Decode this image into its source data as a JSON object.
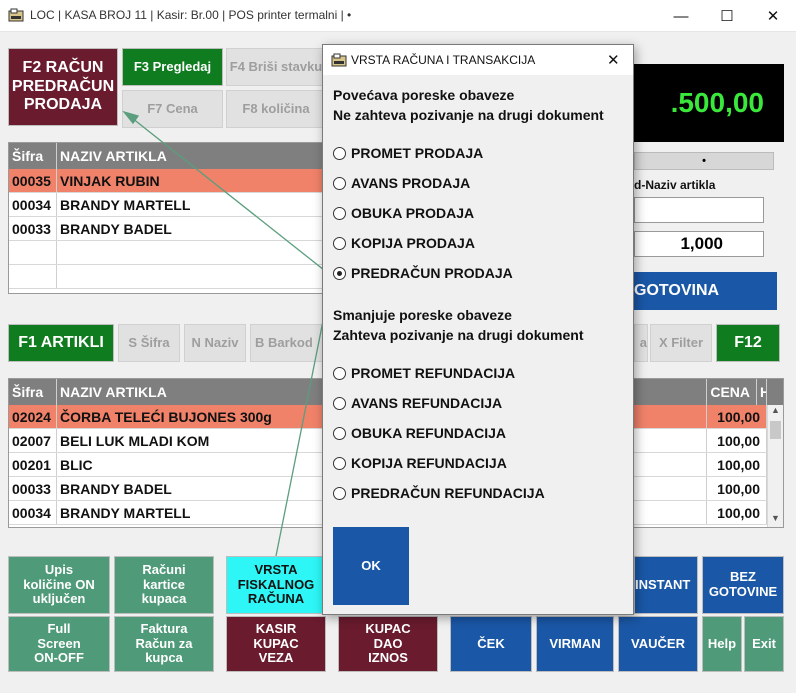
{
  "window": {
    "title": "LOC | KASA BROJ 11 | Kasir:  Br.00 | POS printer termalni |  •",
    "minimize": "—",
    "maximize": "☐",
    "close": "✕"
  },
  "top_buttons": {
    "f2": "F2 RAČUN PREDRAČUN PRODAJA",
    "f3": "F3 Pregledaj",
    "f4": "F4 Briši stavku",
    "f7": "F7 Cena",
    "f8": "F8 količina"
  },
  "total_display": ".500,00",
  "status_dot": "•",
  "lookup": {
    "label": "d-Naziv artikla",
    "quantity": "1,000"
  },
  "gotovina": "GOTOVINA",
  "receipt_grid": {
    "columns": [
      "Šifra",
      "NAZIV ARTIKLA"
    ],
    "rows": [
      {
        "code": "00035",
        "name": "VINJAK RUBIN",
        "selected": true
      },
      {
        "code": "00034",
        "name": "BRANDY MARTELL",
        "selected": false
      },
      {
        "code": "00033",
        "name": "BRANDY BADEL",
        "selected": false
      },
      {
        "code": "",
        "name": "",
        "selected": false
      },
      {
        "code": "",
        "name": "",
        "selected": false
      }
    ]
  },
  "article_bar": {
    "f1": "F1 ARTIKLI",
    "sifra": "S Šifra",
    "naziv": "N Naziv",
    "barkod": "B Barkod",
    "cut": "a",
    "filter": "X Filter",
    "f12": "F12"
  },
  "article_grid": {
    "columns": [
      "Šifra",
      "NAZIV ARTIKLA",
      "CENA",
      "H"
    ],
    "rows": [
      {
        "code": "02024",
        "name": "ČORBA TELEĆI BUJONES 300g",
        "price": "100,00",
        "selected": true
      },
      {
        "code": "02007",
        "name": "BELI LUK MLADI KOM",
        "price": "100,00",
        "selected": false
      },
      {
        "code": "00201",
        "name": "BLIC",
        "price": "100,00",
        "selected": false
      },
      {
        "code": "00033",
        "name": "BRANDY BADEL",
        "price": "100,00",
        "selected": false
      },
      {
        "code": "00034",
        "name": "BRANDY MARTELL",
        "price": "100,00",
        "selected": false
      }
    ],
    "scroll_up": "▲",
    "scroll_down": "▼"
  },
  "bottom_buttons": {
    "upis": "Upis količine ON uključen",
    "racuni": "Računi kartice kupaca",
    "vrsta": "VRSTA FISKALNOG RAČUNA",
    "full": "Full Screen ON-OFF",
    "faktura": "Faktura Račun za kupca",
    "kasir": "KASIR KUPAC VEZA",
    "kupac": "KUPAC DAO IZNOS",
    "instant": "INSTANT",
    "bez": "BEZ GOTOVINE",
    "cek": "ČEK",
    "virman": "VIRMAN",
    "vaucer": "VAUČER",
    "help": "Help",
    "exit": "Exit"
  },
  "dialog": {
    "title": "VRSTA RAČUNA I TRANSAKCIJA",
    "close": "✕",
    "section1_line1": "Povećava poreske obaveze",
    "section1_line2": "Ne zahteva pozivanje na drugi dokument",
    "options1": [
      {
        "label": "PROMET PRODAJA",
        "checked": false
      },
      {
        "label": "AVANS PRODAJA",
        "checked": false
      },
      {
        "label": "OBUKA PRODAJA",
        "checked": false
      },
      {
        "label": "KOPIJA PRODAJA",
        "checked": false
      },
      {
        "label": "PREDRAČUN PRODAJA",
        "checked": true
      }
    ],
    "section2_line1": "Smanjuje poreske obaveze",
    "section2_line2": "Zahteva pozivanje na drugi dokument",
    "options2": [
      {
        "label": "PROMET REFUNDACIJA",
        "checked": false
      },
      {
        "label": "AVANS REFUNDACIJA",
        "checked": false
      },
      {
        "label": "OBUKA REFUNDACIJA",
        "checked": false
      },
      {
        "label": "KOPIJA REFUNDACIJA",
        "checked": false
      },
      {
        "label": "PREDRAČUN REFUNDACIJA",
        "checked": false
      }
    ],
    "ok": "OK"
  },
  "colors": {
    "accent_green": "#0e7c1f",
    "selection": "#f0826a",
    "total_text": "#39e83a",
    "annotation_arrow": "#5a9e7e"
  }
}
